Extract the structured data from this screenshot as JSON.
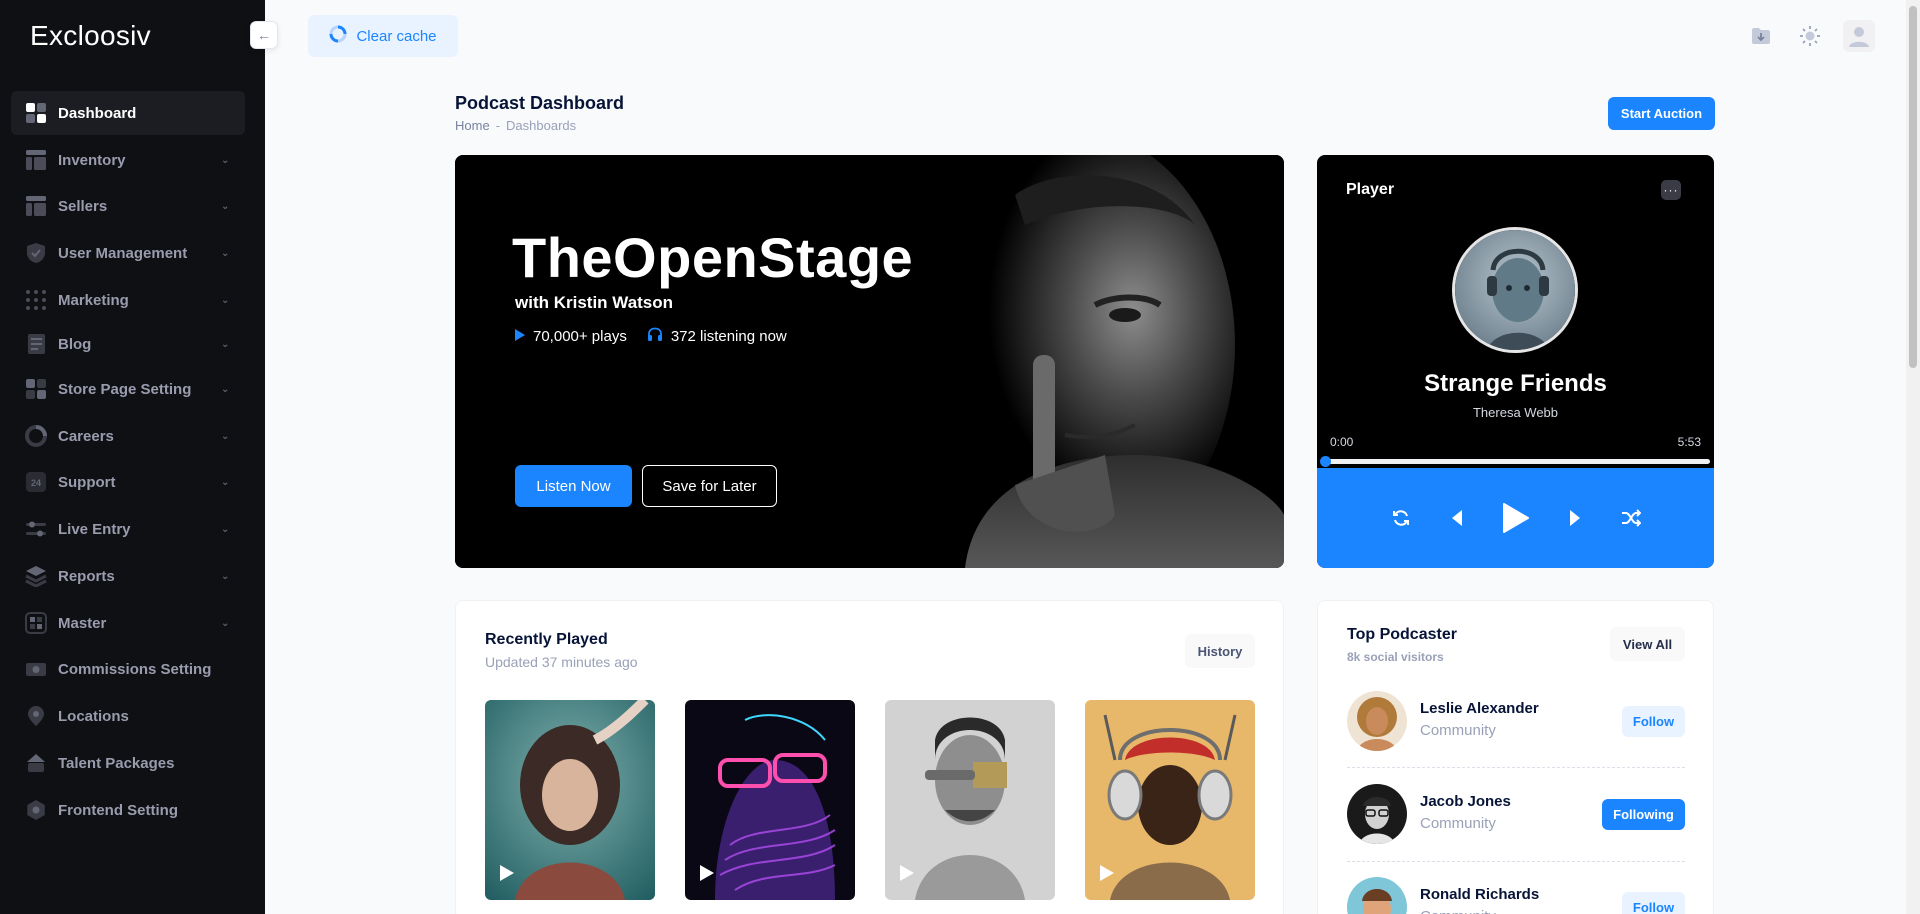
{
  "sidebar": {
    "brand": "Excloosiv",
    "collapse_icon": "arrow-left-icon",
    "items": [
      {
        "label": "Dashboard",
        "icon": "dashboard-icon",
        "active": true,
        "has_submenu": false
      },
      {
        "label": "Inventory",
        "icon": "inventory-icon",
        "has_submenu": true
      },
      {
        "label": "Sellers",
        "icon": "sellers-icon",
        "has_submenu": true
      },
      {
        "label": "User Management",
        "icon": "shield-icon",
        "has_submenu": true
      },
      {
        "label": "Marketing",
        "icon": "grid-dots-icon",
        "has_submenu": true
      },
      {
        "label": "Blog",
        "icon": "blog-icon",
        "has_submenu": true
      },
      {
        "label": "Store Page Setting",
        "icon": "store-icon",
        "has_submenu": true
      },
      {
        "label": "Careers",
        "icon": "careers-icon",
        "has_submenu": true
      },
      {
        "label": "Support",
        "icon": "support-24-icon",
        "icon_text": "24",
        "has_submenu": true
      },
      {
        "label": "Live Entry",
        "icon": "sliders-icon",
        "has_submenu": true
      },
      {
        "label": "Reports",
        "icon": "layers-icon",
        "has_submenu": true
      },
      {
        "label": "Master",
        "icon": "master-icon",
        "has_submenu": true
      },
      {
        "label": "Commissions Setting",
        "icon": "commission-icon",
        "has_submenu": false
      },
      {
        "label": "Locations",
        "icon": "location-icon",
        "has_submenu": false
      },
      {
        "label": "Talent Packages",
        "icon": "package-icon",
        "has_submenu": false
      },
      {
        "label": "Frontend Setting",
        "icon": "settings-icon",
        "has_submenu": false
      }
    ]
  },
  "header": {
    "clear_cache_label": "Clear cache",
    "icons": [
      "download-icon",
      "sun-icon",
      "user-avatar-icon"
    ]
  },
  "page": {
    "title": "Podcast Dashboard",
    "breadcrumb": [
      "Home",
      "-",
      "Dashboards"
    ],
    "primary_action": "Start Auction"
  },
  "hero": {
    "title": "TheOpenStage",
    "subtitle": "with Kristin Watson",
    "plays": "70,000+ plays",
    "listening": "372 listening now",
    "listen_btn": "Listen Now",
    "save_btn": "Save for Later"
  },
  "player": {
    "title": "Player",
    "more_icon": "ellipsis-icon",
    "song": "Strange Friends",
    "artist": "Theresa Webb",
    "time_current": "0:00",
    "time_total": "5:53",
    "progress": 0.0,
    "controls": [
      "repeat-icon",
      "previous-icon",
      "play-icon",
      "next-icon",
      "shuffle-icon"
    ]
  },
  "recent": {
    "title": "Recently Played",
    "subtitle": "Updated 37 minutes ago",
    "history_btn": "History",
    "items": [
      {
        "thumb": "woman-portrait-thumbnail"
      },
      {
        "thumb": "neon-glasses-thumbnail"
      },
      {
        "thumb": "man-brush-thumbnail"
      },
      {
        "thumb": "headphones-thumbnail"
      }
    ]
  },
  "top_podcaster": {
    "title": "Top Podcaster",
    "subtitle": "8k social visitors",
    "view_all": "View All",
    "people": [
      {
        "name": "Leslie Alexander",
        "role": "Community",
        "action": "Follow",
        "following": false
      },
      {
        "name": "Jacob Jones",
        "role": "Community",
        "action": "Following",
        "following": true
      },
      {
        "name": "Ronald Richards",
        "role": "Community",
        "action": "Follow",
        "following": false
      }
    ]
  },
  "colors": {
    "primary": "#1b84ff",
    "sidebar_bg": "#0f1014",
    "page_bg": "#f9fafc",
    "light_primary": "#e9f3ff"
  }
}
